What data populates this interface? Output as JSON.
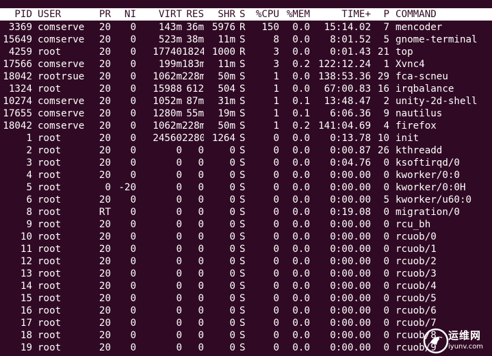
{
  "top": {
    "columns": [
      "PID",
      "USER",
      "PR",
      "NI",
      "VIRT",
      "RES",
      "SHR",
      "S",
      "%CPU",
      "%MEM",
      "TIME+",
      "P",
      "COMMAND"
    ],
    "rows": [
      [
        "3369",
        "comserve",
        "20",
        "0",
        "143m",
        "36m",
        "5976",
        "R",
        "150",
        "0.0",
        "15:14.02",
        "7",
        "mencoder"
      ],
      [
        "15649",
        "comserve",
        "20",
        "0",
        "523m",
        "38m",
        "11m",
        "S",
        "8",
        "0.0",
        "8:01.52",
        "5",
        "gnome-terminal"
      ],
      [
        "4259",
        "root",
        "20",
        "0",
        "17740",
        "1824",
        "1000",
        "R",
        "3",
        "0.0",
        "0:01.43",
        "21",
        "top"
      ],
      [
        "17566",
        "comserve",
        "20",
        "0",
        "199m",
        "183m",
        "11m",
        "S",
        "3",
        "0.2",
        "122:12.24",
        "1",
        "Xvnc4"
      ],
      [
        "18042",
        "rootrsue",
        "20",
        "0",
        "1062m",
        "228m",
        "50m",
        "S",
        "1",
        "0.0",
        "138:53.36",
        "29",
        "fca-scneu"
      ],
      [
        "1324",
        "root",
        "20",
        "0",
        "15988",
        "612",
        "504",
        "S",
        "1",
        "0.0",
        "67:00.83",
        "16",
        "irqbalance"
      ],
      [
        "10274",
        "comserve",
        "20",
        "0",
        "1052m",
        "87m",
        "31m",
        "S",
        "1",
        "0.1",
        "13:48.47",
        "2",
        "unity-2d-shell"
      ],
      [
        "17655",
        "comserve",
        "20",
        "0",
        "1280m",
        "55m",
        "19m",
        "S",
        "1",
        "0.1",
        "6:06.36",
        "9",
        "nautilus"
      ],
      [
        "18042",
        "comserve",
        "20",
        "0",
        "1062m",
        "228m",
        "50m",
        "S",
        "1",
        "0.2",
        "141:04.69",
        "4",
        "firefox"
      ],
      [
        "1",
        "root",
        "20",
        "0",
        "24560",
        "2280",
        "1264",
        "S",
        "0",
        "0.0",
        "0:13.78",
        "10",
        "init"
      ],
      [
        "2",
        "root",
        "20",
        "0",
        "0",
        "0",
        "0",
        "S",
        "0",
        "0.0",
        "0:00.87",
        "26",
        "kthreadd"
      ],
      [
        "3",
        "root",
        "20",
        "0",
        "0",
        "0",
        "0",
        "S",
        "0",
        "0.0",
        "0:04.76",
        "0",
        "ksoftirqd/0"
      ],
      [
        "4",
        "root",
        "20",
        "0",
        "0",
        "0",
        "0",
        "S",
        "0",
        "0.0",
        "0:00.00",
        "0",
        "kworker/0:0"
      ],
      [
        "5",
        "root",
        "0",
        "-20",
        "0",
        "0",
        "0",
        "S",
        "0",
        "0.0",
        "0:00.00",
        "0",
        "kworker/0:0H"
      ],
      [
        "6",
        "root",
        "20",
        "0",
        "0",
        "0",
        "0",
        "S",
        "0",
        "0.0",
        "0:00.00",
        "5",
        "kworker/u60:0"
      ],
      [
        "8",
        "root",
        "RT",
        "0",
        "0",
        "0",
        "0",
        "S",
        "0",
        "0.0",
        "0:19.08",
        "0",
        "migration/0"
      ],
      [
        "9",
        "root",
        "20",
        "0",
        "0",
        "0",
        "0",
        "S",
        "0",
        "0.0",
        "0:00.00",
        "0",
        "rcu_bh"
      ],
      [
        "10",
        "root",
        "20",
        "0",
        "0",
        "0",
        "0",
        "S",
        "0",
        "0.0",
        "0:00.00",
        "0",
        "rcuob/0"
      ],
      [
        "11",
        "root",
        "20",
        "0",
        "0",
        "0",
        "0",
        "S",
        "0",
        "0.0",
        "0:00.00",
        "0",
        "rcuob/1"
      ],
      [
        "12",
        "root",
        "20",
        "0",
        "0",
        "0",
        "0",
        "S",
        "0",
        "0.0",
        "0:00.00",
        "0",
        "rcuob/2"
      ],
      [
        "13",
        "root",
        "20",
        "0",
        "0",
        "0",
        "0",
        "S",
        "0",
        "0.0",
        "0:00.00",
        "0",
        "rcuob/3"
      ],
      [
        "14",
        "root",
        "20",
        "0",
        "0",
        "0",
        "0",
        "S",
        "0",
        "0.0",
        "0:00.00",
        "0",
        "rcuob/4"
      ],
      [
        "15",
        "root",
        "20",
        "0",
        "0",
        "0",
        "0",
        "S",
        "0",
        "0.0",
        "0:00.00",
        "0",
        "rcuob/5"
      ],
      [
        "16",
        "root",
        "20",
        "0",
        "0",
        "0",
        "0",
        "S",
        "0",
        "0.0",
        "0:00.00",
        "0",
        "rcuob/6"
      ],
      [
        "17",
        "root",
        "20",
        "0",
        "0",
        "0",
        "0",
        "S",
        "0",
        "0.0",
        "0:00.00",
        "0",
        "rcuob/7"
      ],
      [
        "18",
        "root",
        "20",
        "0",
        "0",
        "0",
        "0",
        "S",
        "0",
        "0.0",
        "0:00.00",
        "0",
        "rcuob/8"
      ],
      [
        "19",
        "root",
        "20",
        "0",
        "0",
        "0",
        "0",
        "S",
        "0",
        "0.0",
        "0:00.00",
        "0",
        "rcuob/9"
      ]
    ]
  },
  "watermark": {
    "brand": "运维网",
    "url": "iyunv.com",
    "icon": "bird-logo-icon"
  },
  "colors": {
    "background": "#300a24",
    "text": "#ffffff",
    "header_bg": "#ffffff",
    "header_text": "#300a24"
  }
}
